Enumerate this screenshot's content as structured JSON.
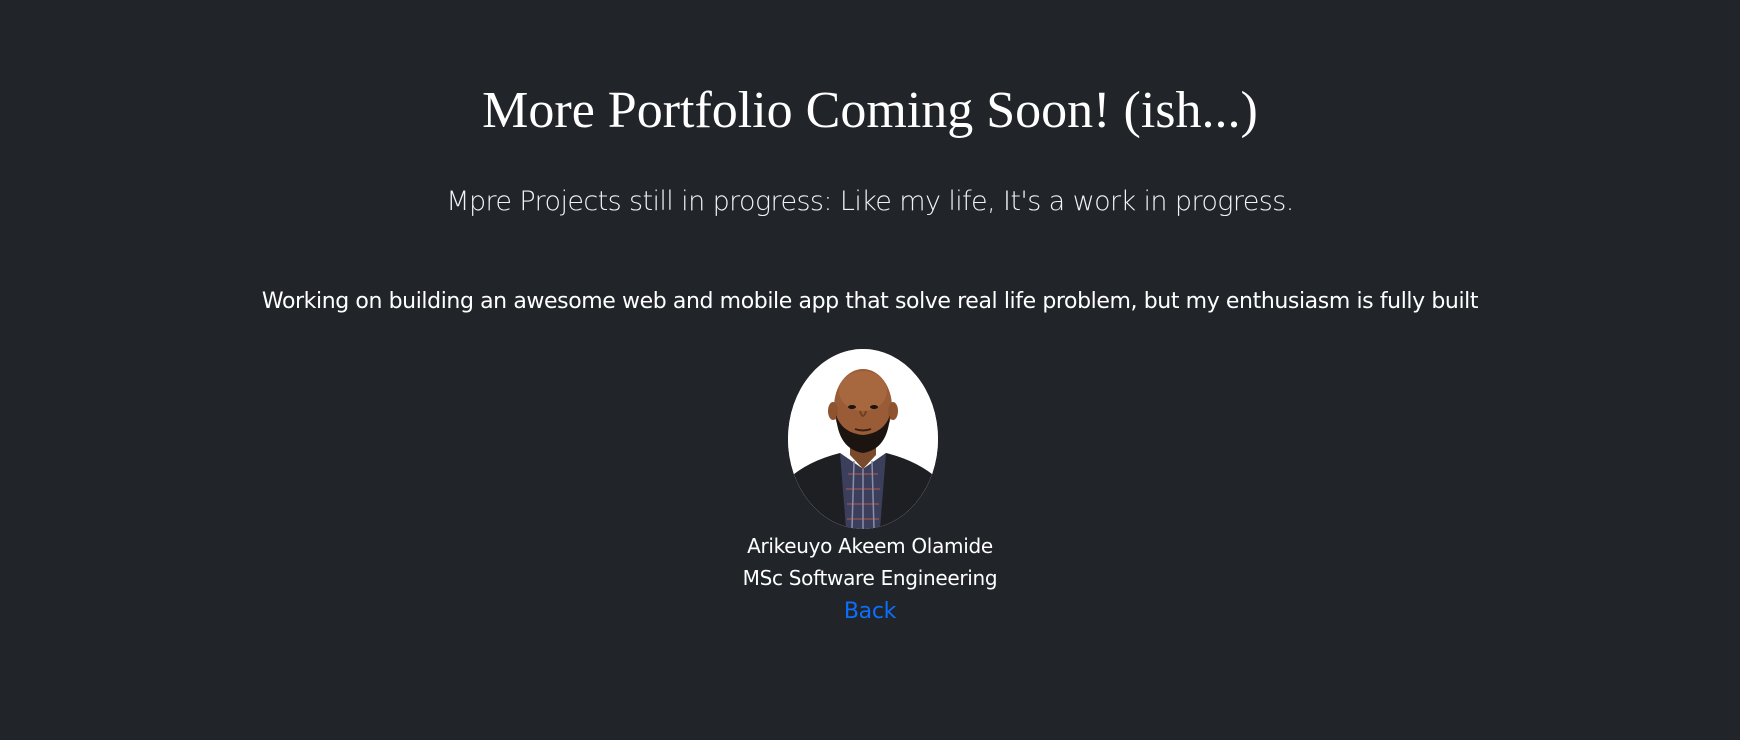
{
  "page": {
    "title": "More Portfolio Coming Soon! (ish...)",
    "subtitle": "Mpre Projects still in progress: Like my life, It's a work in progress.",
    "description": "Working on building an awesome web and mobile app that solve real life problem, but my enthusiasm is fully built"
  },
  "profile": {
    "name": "Arikeuyo Akeem Olamide",
    "degree": "MSc Software Engineering",
    "avatar_icon": "person-photo-avatar"
  },
  "nav": {
    "back_label": "Back"
  },
  "colors": {
    "background": "#212529",
    "text": "#ffffff",
    "link": "#0d6efd"
  }
}
